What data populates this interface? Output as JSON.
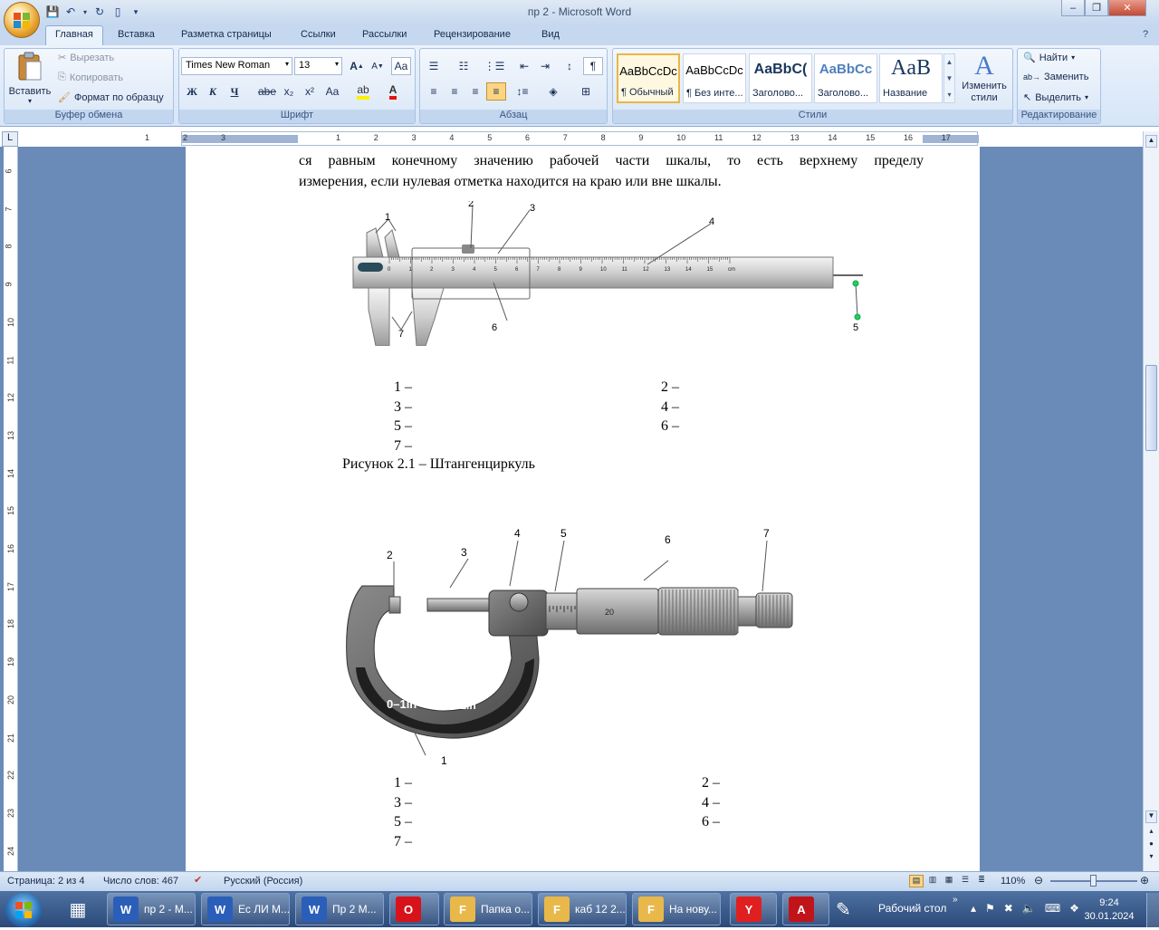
{
  "window": {
    "title": "пр 2 - Microsoft Word"
  },
  "tabs": [
    "Главная",
    "Вставка",
    "Разметка страницы",
    "Ссылки",
    "Рассылки",
    "Рецензирование",
    "Вид"
  ],
  "clipboard": {
    "paste": "Вставить",
    "cut": "Вырезать",
    "copy": "Копировать",
    "format_painter": "Формат по образцу",
    "label": "Буфер обмена"
  },
  "font": {
    "name": "Times New Roman",
    "size": "13",
    "label": "Шрифт",
    "bold": "Ж",
    "italic": "К",
    "underline": "Ч",
    "strike": "abe",
    "sub": "x₂",
    "sup": "x²",
    "case": "Aa"
  },
  "paragraph": {
    "label": "Абзац"
  },
  "styles": {
    "label": "Стили",
    "items": [
      {
        "preview": "AaBbCcDc",
        "name": "¶ Обычный"
      },
      {
        "preview": "AaBbCcDc",
        "name": "¶ Без инте..."
      },
      {
        "preview": "AaBbC(",
        "name": "Заголово..."
      },
      {
        "preview": "AaBbCc",
        "name": "Заголово..."
      },
      {
        "preview": "AaB",
        "name": "Название"
      }
    ],
    "change": "Изменить стили"
  },
  "editing": {
    "label": "Редактирование",
    "find": "Найти",
    "replace": "Заменить",
    "select": "Выделить"
  },
  "ruler": {
    "h_ticks": [
      "3",
      "2",
      "1",
      "1",
      "2",
      "3",
      "4",
      "5",
      "6",
      "7",
      "8",
      "9",
      "10",
      "11",
      "12",
      "13",
      "14",
      "15",
      "16",
      "17"
    ],
    "v_ticks": [
      "6",
      "7",
      "8",
      "9",
      "10",
      "11",
      "12",
      "13",
      "14",
      "15",
      "16",
      "17",
      "18",
      "19",
      "20",
      "21",
      "22",
      "23",
      "24"
    ]
  },
  "doc": {
    "line1": "ся равным конечному значению рабочей части шкалы, то есть верхнему пределу",
    "line2": "измерения, если нулевая отметка находится на краю или вне шкалы.",
    "fig1": {
      "callouts": [
        "1",
        "2",
        "3",
        "4",
        "5",
        "6",
        "7"
      ],
      "scale": [
        "0",
        "1",
        "2",
        "3",
        "4",
        "5",
        "6",
        "7",
        "8",
        "9",
        "10",
        "11",
        "12",
        "13",
        "14",
        "15",
        "cm"
      ],
      "list": [
        [
          "1 –",
          "2 –"
        ],
        [
          "3 –",
          "4 –"
        ],
        [
          "5 –",
          "6 –"
        ],
        [
          "7 –",
          ""
        ]
      ],
      "caption": "Рисунок 2.1 – Штангенциркуль"
    },
    "fig2": {
      "callouts": [
        "1",
        "2",
        "3",
        "4",
        "5",
        "6",
        "7"
      ],
      "frame_text1": "0–1in",
      "frame_text2": "0.001in",
      "sleeve_num": "20",
      "list": [
        [
          "1 –",
          "2 –"
        ],
        [
          "3 –",
          "4 –"
        ],
        [
          "5 –",
          "6 –"
        ],
        [
          "7 –",
          ""
        ]
      ]
    }
  },
  "status": {
    "page": "Страница: 2 из 4",
    "words": "Число слов: 467",
    "lang": "Русский (Россия)",
    "zoom": "110%"
  },
  "taskbar": {
    "items": [
      {
        "label": "пр 2 - М...",
        "icon": "W"
      },
      {
        "label": "Ес ЛИ М...",
        "icon": "W"
      },
      {
        "label": "Пр 2 М...",
        "icon": "W"
      },
      {
        "label": "",
        "icon": "O"
      },
      {
        "label": "Папка о...",
        "icon": "F"
      },
      {
        "label": "каб 12 2...",
        "icon": "F"
      },
      {
        "label": "На нову...",
        "icon": "F"
      },
      {
        "label": "",
        "icon": "Y"
      },
      {
        "label": "",
        "icon": "A"
      }
    ],
    "desktop": "Рабочий стол",
    "time": "9:24",
    "date": "30.01.2024"
  }
}
